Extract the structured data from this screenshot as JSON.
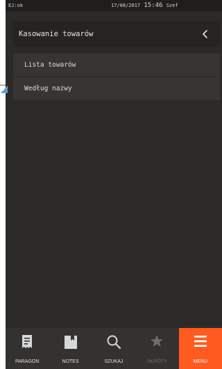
{
  "status_bar": {
    "ej_status": "EJ:ok",
    "date": "17/08/2017",
    "time": "15:46",
    "user": "Szef"
  },
  "header": {
    "title": "Kasowanie towarów",
    "back_icon": "chevron-left-icon"
  },
  "menu": {
    "items": [
      {
        "label": "Lista towarów"
      },
      {
        "label": "Według nazwy"
      }
    ]
  },
  "bottom_nav": {
    "items": [
      {
        "label": "PARAGON",
        "icon": "receipt-icon",
        "state": "normal"
      },
      {
        "label": "NOTES",
        "icon": "notebook-icon",
        "state": "normal"
      },
      {
        "label": "SZUKAJ",
        "icon": "search-icon",
        "state": "normal"
      },
      {
        "label": "SKRÓTY",
        "icon": "star-icon",
        "state": "disabled"
      },
      {
        "label": "MENU",
        "icon": "menu-icon",
        "state": "active"
      }
    ]
  },
  "colors": {
    "background": "#2b2a28",
    "header_bg": "#252422",
    "item_bg": "#363532",
    "nav_bg": "#333230",
    "accent": "#ff5a1f",
    "edge_arrow": "#5aa0d6"
  }
}
